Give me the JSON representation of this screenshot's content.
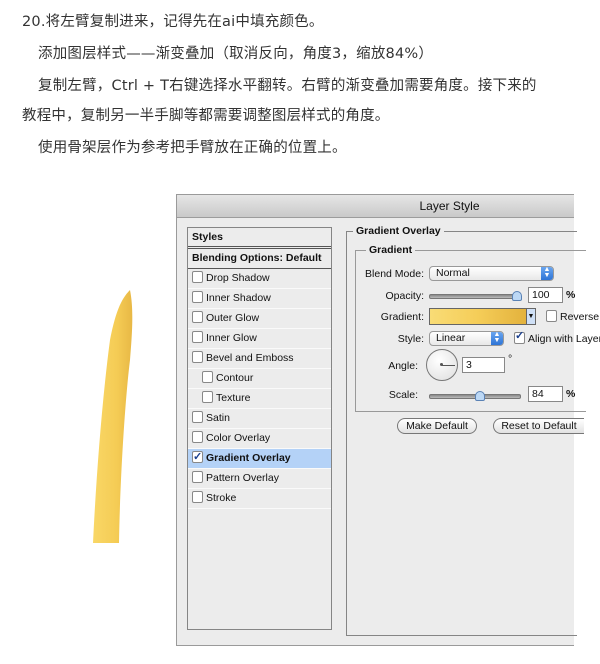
{
  "article": {
    "paragraphs": [
      "20.将左臂复制进来，记得先在ai中填充颜色。",
      "添加图层样式——渐变叠加（取消反向，角度3，缩放84%）",
      "复制左臂，Ctrl + T右键选择水平翻转。右臂的渐变叠加需要角度。接下来的",
      "教程中，复制另一半手脚等都需要调整图层样式的角度。",
      "使用骨架层作为参考把手臂放在正确的位置上。"
    ]
  },
  "illustration": {
    "name": "left-arm-shape",
    "fill_color": "#f5cd58"
  },
  "dialog": {
    "title": "Layer Style",
    "styles_panel": {
      "header": "Styles",
      "blending_options": "Blending Options: Default",
      "items": [
        {
          "label": "Drop Shadow",
          "checked": false,
          "indent": false
        },
        {
          "label": "Inner Shadow",
          "checked": false,
          "indent": false
        },
        {
          "label": "Outer Glow",
          "checked": false,
          "indent": false
        },
        {
          "label": "Inner Glow",
          "checked": false,
          "indent": false
        },
        {
          "label": "Bevel and Emboss",
          "checked": false,
          "indent": false
        },
        {
          "label": "Contour",
          "checked": false,
          "indent": true
        },
        {
          "label": "Texture",
          "checked": false,
          "indent": true
        },
        {
          "label": "Satin",
          "checked": false,
          "indent": false
        },
        {
          "label": "Color Overlay",
          "checked": false,
          "indent": false
        },
        {
          "label": "Gradient Overlay",
          "checked": true,
          "indent": false,
          "selected": true
        },
        {
          "label": "Pattern Overlay",
          "checked": false,
          "indent": false
        },
        {
          "label": "Stroke",
          "checked": false,
          "indent": false
        }
      ]
    },
    "gradient_overlay": {
      "section_title": "Gradient Overlay",
      "group_title": "Gradient",
      "blend_mode_label": "Blend Mode:",
      "blend_mode_value": "Normal",
      "opacity_label": "Opacity:",
      "opacity_value": "100",
      "opacity_unit": "%",
      "opacity_slider_fraction": 1.0,
      "gradient_label": "Gradient:",
      "gradient_colors": [
        "#f9dc76",
        "#f5cd58",
        "#e3b23d"
      ],
      "reverse_label": "Reverse",
      "reverse_checked": false,
      "style_label": "Style:",
      "style_value": "Linear",
      "align_label": "Align with Layer",
      "align_checked": true,
      "angle_label": "Angle:",
      "angle_value": "3",
      "angle_unit": "°",
      "scale_label": "Scale:",
      "scale_value": "84",
      "scale_unit": "%",
      "scale_slider_fraction": 0.55,
      "make_default_label": "Make Default",
      "reset_default_label": "Reset to Default"
    }
  }
}
